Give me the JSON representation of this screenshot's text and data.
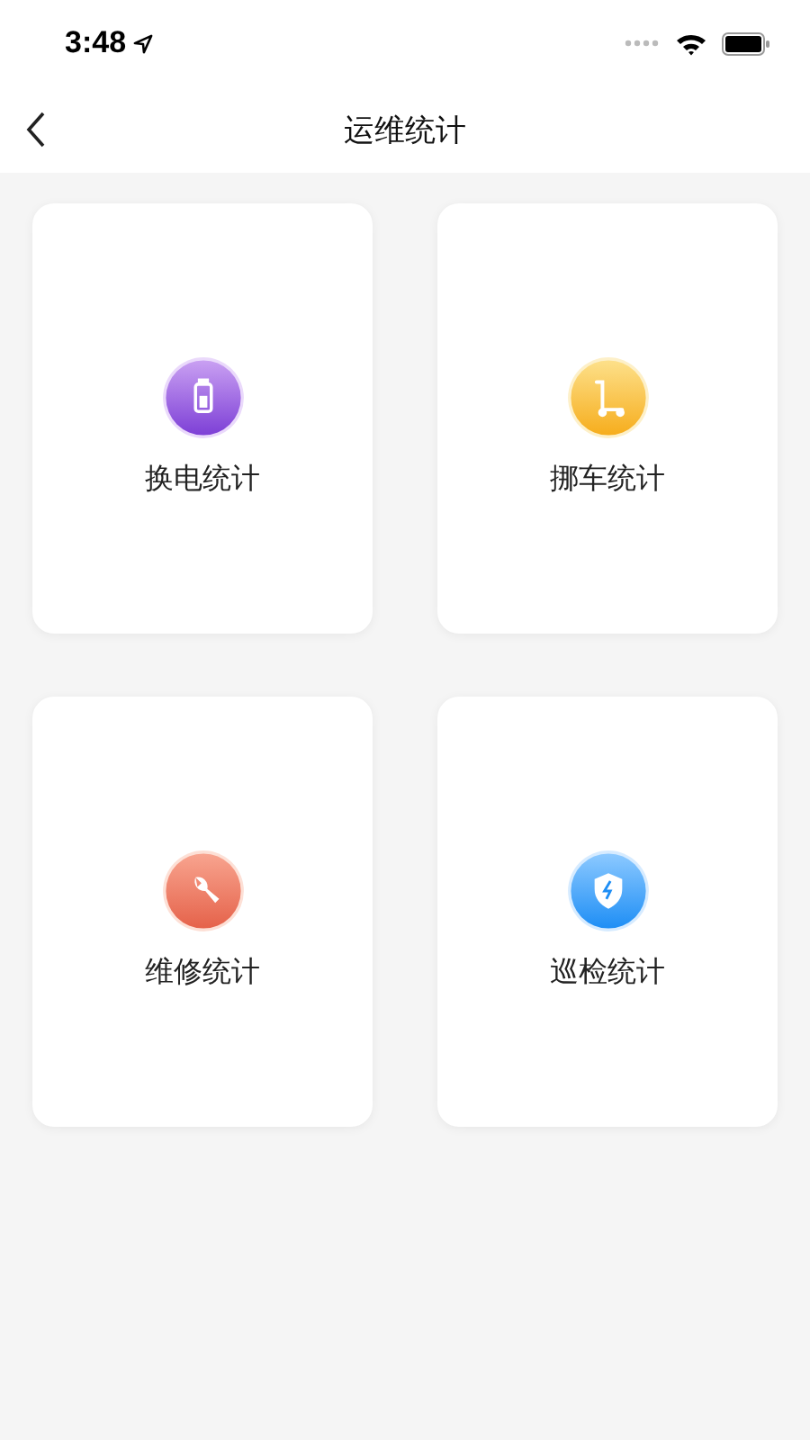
{
  "status_bar": {
    "time": "3:48"
  },
  "nav": {
    "title": "运维统计"
  },
  "cards": [
    {
      "kind": "battery",
      "label": "换电统计"
    },
    {
      "kind": "cart",
      "label": "挪车统计"
    },
    {
      "kind": "wrench",
      "label": "维修统计"
    },
    {
      "kind": "shield",
      "label": "巡检统计"
    }
  ]
}
